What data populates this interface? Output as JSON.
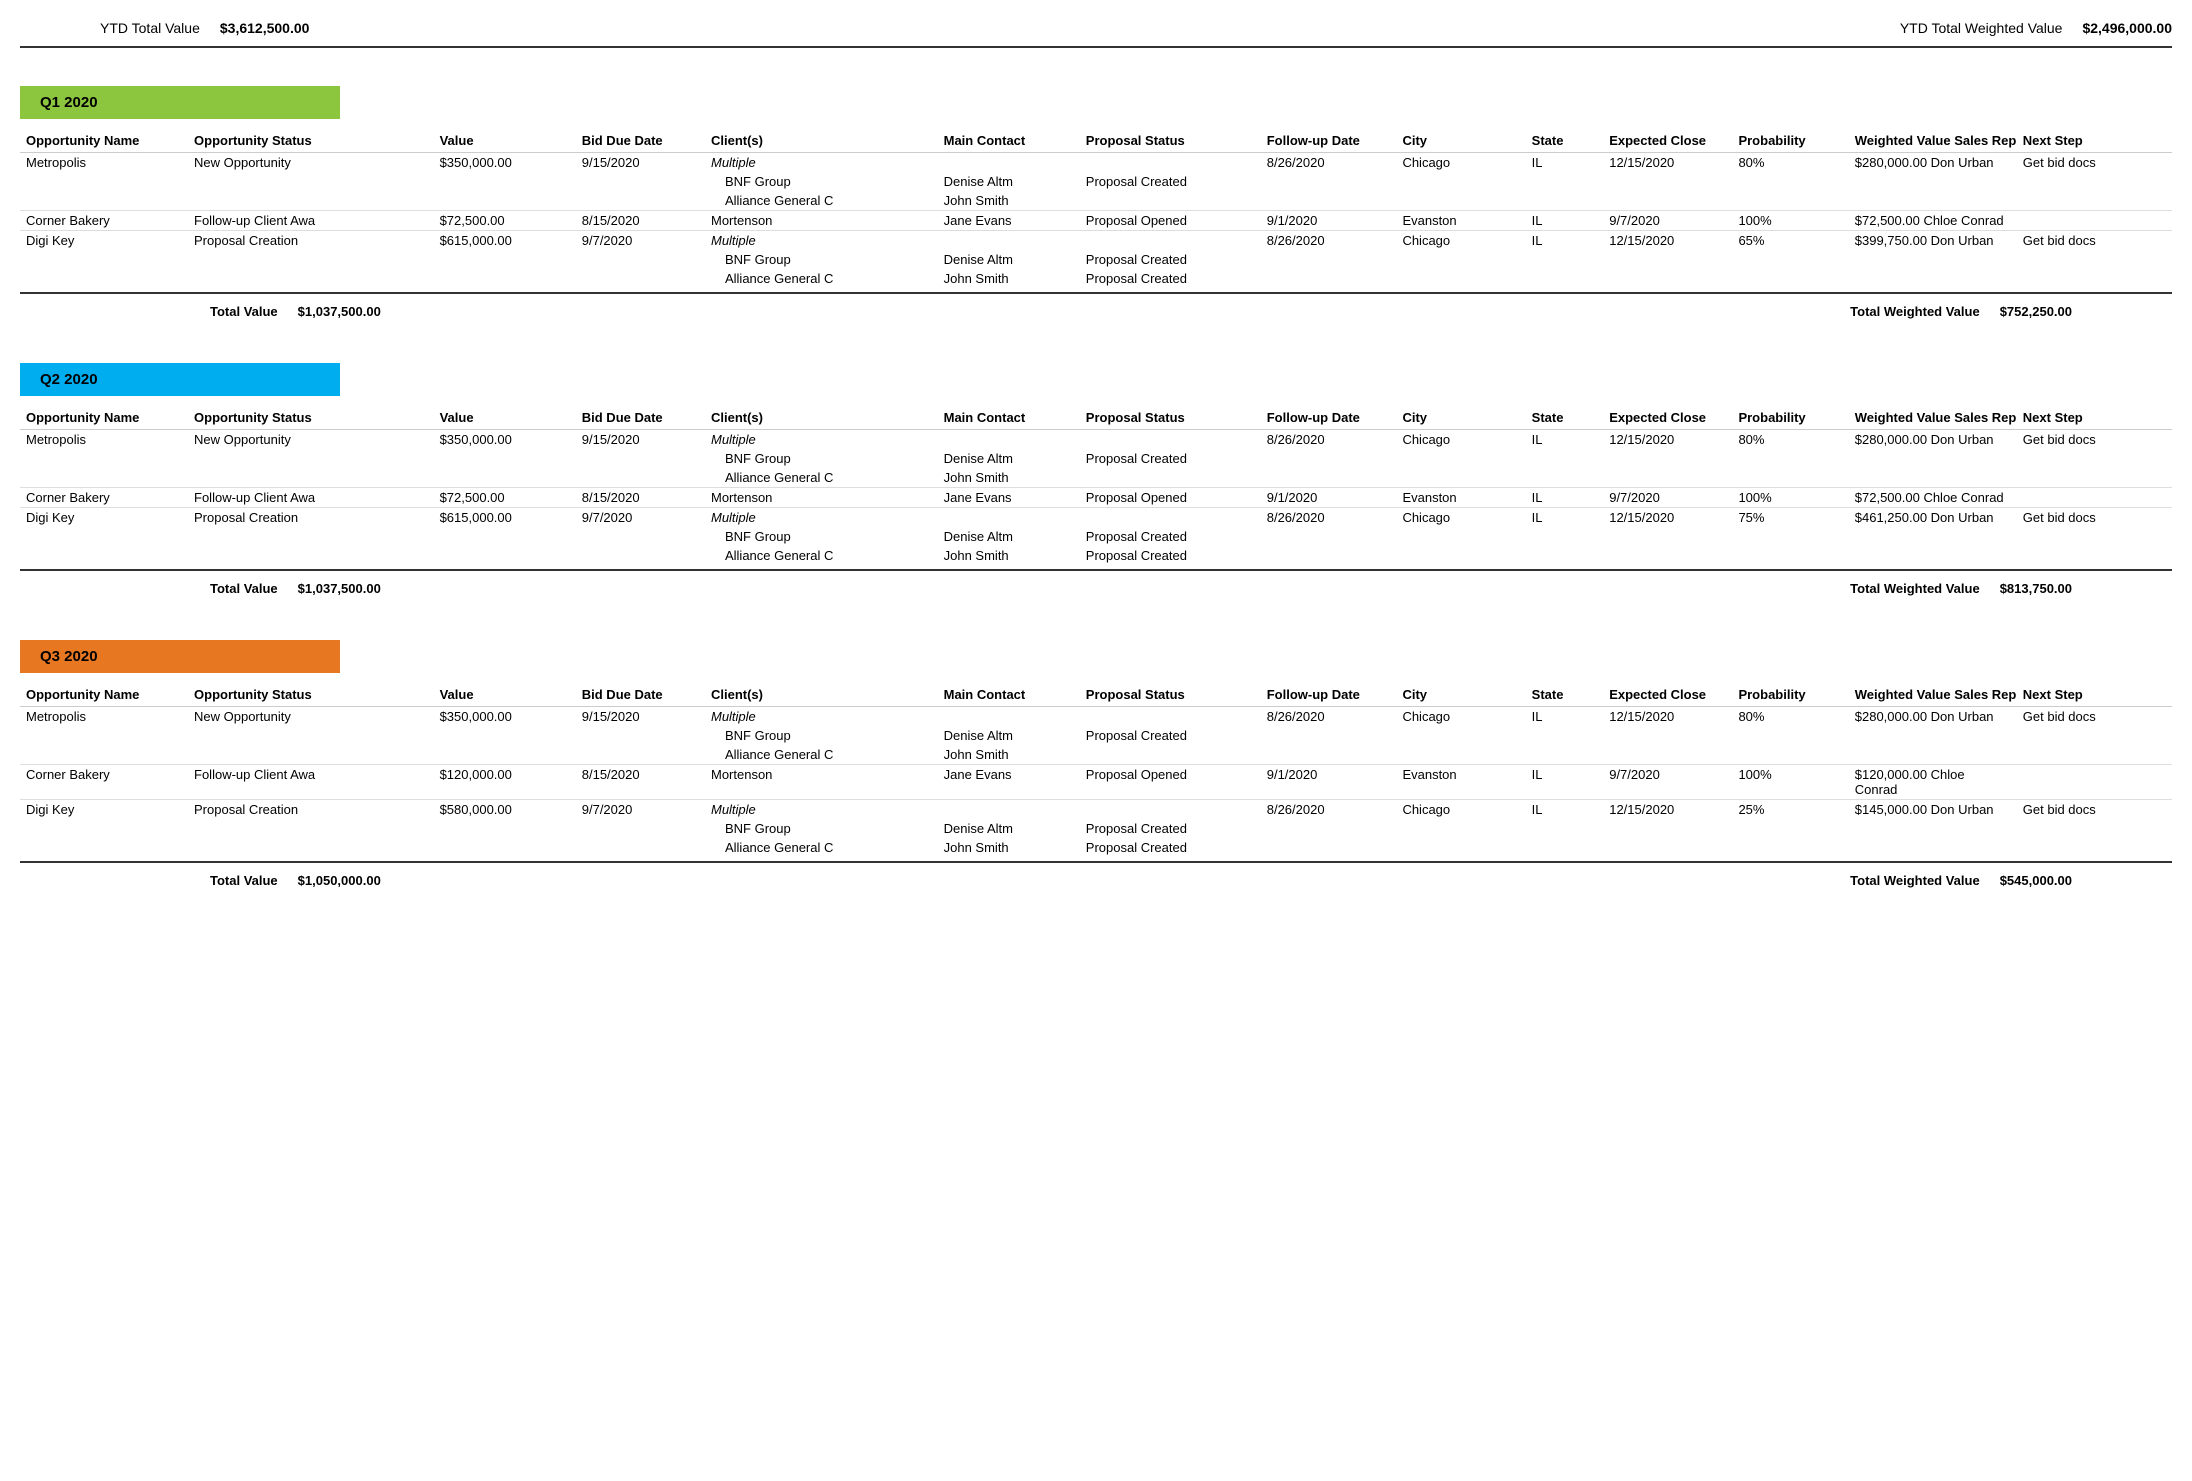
{
  "ytd": {
    "total_label": "YTD Total Value",
    "total_value": "$3,612,500.00",
    "weighted_label": "YTD Total Weighted Value",
    "weighted_value": "$2,496,000.00"
  },
  "columns": {
    "opp_name": "Opportunity Name",
    "opp_status": "Opportunity Status",
    "value": "Value",
    "bid_due": "Bid Due Date",
    "clients": "Client(s)",
    "main_contact": "Main Contact",
    "proposal_status": "Proposal Status",
    "followup_date": "Follow-up Date",
    "city": "City",
    "state": "State",
    "expected_close": "Expected Close",
    "probability": "Probability",
    "weighted_value": "Weighted Value",
    "sales_rep": "Sales Rep",
    "next_step": "Next Step"
  },
  "quarters": [
    {
      "id": "q1",
      "label": "Q1 2020",
      "color_class": "q1-bar",
      "total_value_label": "Total Value",
      "total_value": "$1,037,500.00",
      "total_weighted_label": "Total Weighted Value",
      "total_weighted": "$752,250.00",
      "rows": [
        {
          "name": "Metropolis",
          "status": "New Opportunity",
          "value": "$350,000.00",
          "bid_due": "9/15/2020",
          "clients": "Multiple",
          "clients_italic": true,
          "contact": "",
          "proposal_status": "",
          "followup": "8/26/2020",
          "city": "Chicago",
          "state": "IL",
          "expected_close": "12/15/2020",
          "probability": "80%",
          "weighted": "$280,000.00",
          "rep": "Don Urban",
          "next_step": "Get bid docs",
          "sub_rows": [
            {
              "clients": "BNF Group",
              "contact": "Denise Altm",
              "proposal": "Proposal Created"
            },
            {
              "clients": "Alliance General C",
              "contact": "John Smith",
              "proposal": ""
            }
          ]
        },
        {
          "name": "Corner Bakery",
          "status": "Follow-up Client Awa",
          "value": "$72,500.00",
          "bid_due": "8/15/2020",
          "clients": "Mortenson",
          "clients_italic": false,
          "contact": "Jane Evans",
          "proposal_status": "Proposal Opened",
          "followup": "9/1/2020",
          "city": "Evanston",
          "state": "IL",
          "expected_close": "9/7/2020",
          "probability": "100%",
          "weighted": "$72,500.00",
          "rep": "Chloe Conrad",
          "next_step": "",
          "sub_rows": []
        },
        {
          "name": "Digi Key",
          "status": "Proposal Creation",
          "value": "$615,000.00",
          "bid_due": "9/7/2020",
          "clients": "Multiple",
          "clients_italic": true,
          "contact": "",
          "proposal_status": "",
          "followup": "8/26/2020",
          "city": "Chicago",
          "state": "IL",
          "expected_close": "12/15/2020",
          "probability": "65%",
          "weighted": "$399,750.00",
          "rep": "Don Urban",
          "next_step": "Get bid docs",
          "sub_rows": [
            {
              "clients": "BNF Group",
              "contact": "Denise Altm",
              "proposal": "Proposal Created"
            },
            {
              "clients": "Alliance General C",
              "contact": "John Smith",
              "proposal": "Proposal Created"
            }
          ]
        }
      ]
    },
    {
      "id": "q2",
      "label": "Q2 2020",
      "color_class": "q2-bar",
      "total_value_label": "Total Value",
      "total_value": "$1,037,500.00",
      "total_weighted_label": "Total Weighted Value",
      "total_weighted": "$813,750.00",
      "rows": [
        {
          "name": "Metropolis",
          "status": "New Opportunity",
          "value": "$350,000.00",
          "bid_due": "9/15/2020",
          "clients": "Multiple",
          "clients_italic": true,
          "contact": "",
          "proposal_status": "",
          "followup": "8/26/2020",
          "city": "Chicago",
          "state": "IL",
          "expected_close": "12/15/2020",
          "probability": "80%",
          "weighted": "$280,000.00",
          "rep": "Don Urban",
          "next_step": "Get bid docs",
          "sub_rows": [
            {
              "clients": "BNF Group",
              "contact": "Denise Altm",
              "proposal": "Proposal Created"
            },
            {
              "clients": "Alliance General C",
              "contact": "John Smith",
              "proposal": ""
            }
          ]
        },
        {
          "name": "Corner Bakery",
          "status": "Follow-up Client Awa",
          "value": "$72,500.00",
          "bid_due": "8/15/2020",
          "clients": "Mortenson",
          "clients_italic": false,
          "contact": "Jane Evans",
          "proposal_status": "Proposal Opened",
          "followup": "9/1/2020",
          "city": "Evanston",
          "state": "IL",
          "expected_close": "9/7/2020",
          "probability": "100%",
          "weighted": "$72,500.00",
          "rep": "Chloe Conrad",
          "next_step": "",
          "sub_rows": []
        },
        {
          "name": "Digi Key",
          "status": "Proposal Creation",
          "value": "$615,000.00",
          "bid_due": "9/7/2020",
          "clients": "Multiple",
          "clients_italic": true,
          "contact": "",
          "proposal_status": "",
          "followup": "8/26/2020",
          "city": "Chicago",
          "state": "IL",
          "expected_close": "12/15/2020",
          "probability": "75%",
          "weighted": "$461,250.00",
          "rep": "Don Urban",
          "next_step": "Get bid docs",
          "sub_rows": [
            {
              "clients": "BNF Group",
              "contact": "Denise Altm",
              "proposal": "Proposal Created"
            },
            {
              "clients": "Alliance General C",
              "contact": "John Smith",
              "proposal": "Proposal Created"
            }
          ]
        }
      ]
    },
    {
      "id": "q3",
      "label": "Q3 2020",
      "color_class": "q3-bar",
      "total_value_label": "Total Value",
      "total_value": "$1,050,000.00",
      "total_weighted_label": "Total Weighted Value",
      "total_weighted": "$545,000.00",
      "rows": [
        {
          "name": "Metropolis",
          "status": "New Opportunity",
          "value": "$350,000.00",
          "bid_due": "9/15/2020",
          "clients": "Multiple",
          "clients_italic": true,
          "contact": "",
          "proposal_status": "",
          "followup": "8/26/2020",
          "city": "Chicago",
          "state": "IL",
          "expected_close": "12/15/2020",
          "probability": "80%",
          "weighted": "$280,000.00",
          "rep": "Don Urban",
          "next_step": "Get bid docs",
          "sub_rows": [
            {
              "clients": "BNF Group",
              "contact": "Denise Altm",
              "proposal": "Proposal Created"
            },
            {
              "clients": "Alliance General C",
              "contact": "John Smith",
              "proposal": ""
            }
          ]
        },
        {
          "name": "Corner Bakery",
          "status": "Follow-up Client Awa",
          "value": "$120,000.00",
          "bid_due": "8/15/2020",
          "clients": "Mortenson",
          "clients_italic": false,
          "contact": "Jane Evans",
          "proposal_status": "Proposal Opened",
          "followup": "9/1/2020",
          "city": "Evanston",
          "state": "IL",
          "expected_close": "9/7/2020",
          "probability": "100%",
          "weighted": "$120,000.00",
          "rep": "Chloe Conrad",
          "next_step": "",
          "sub_rows": []
        },
        {
          "name": "Digi Key",
          "status": "Proposal Creation",
          "value": "$580,000.00",
          "bid_due": "9/7/2020",
          "clients": "Multiple",
          "clients_italic": true,
          "contact": "",
          "proposal_status": "",
          "followup": "8/26/2020",
          "city": "Chicago",
          "state": "IL",
          "expected_close": "12/15/2020",
          "probability": "25%",
          "weighted": "$145,000.00",
          "rep": "Don Urban",
          "next_step": "Get bid docs",
          "sub_rows": [
            {
              "clients": "BNF Group",
              "contact": "Denise Altm",
              "proposal": "Proposal Created"
            },
            {
              "clients": "Alliance General C",
              "contact": "John Smith",
              "proposal": "Proposal Created"
            }
          ]
        }
      ]
    }
  ]
}
